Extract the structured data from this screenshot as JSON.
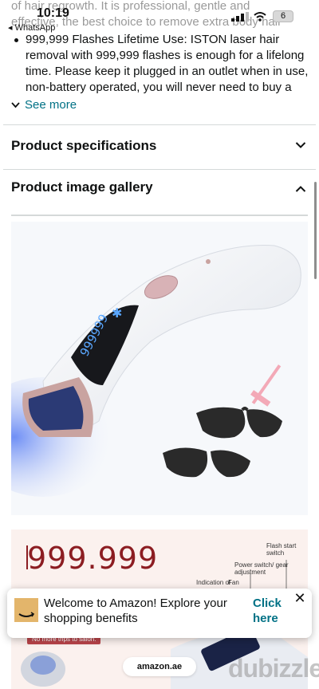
{
  "status_bar": {
    "time": "10:19",
    "back_app": "WhatsApp",
    "battery": "6"
  },
  "description": {
    "line1": "of hair regrowth. It is professional, gentle and",
    "line2": "effective, the best choice to remove extra body hair",
    "bullet": "999,999 Flashes Lifetime Use: ISTON laser hair removal with 999,999 flashes is enough for a lifelong time. Please keep it plugged in an outlet when in use, non-battery operated, you will never need to buy a",
    "see_more": "See more"
  },
  "sections": {
    "specifications": "Product specifications",
    "gallery": "Product image gallery"
  },
  "gallery": {
    "image1": {
      "device_screen": "999999"
    },
    "image2": {
      "big_number": "999.999",
      "callouts": [
        "Flash start switch",
        "Power switch/ gear adjustment",
        "Indication of",
        "Fan"
      ],
      "tag": "No more trips to salon."
    }
  },
  "banner": {
    "message": "Welcome to Amazon! Explore your shopping benefits",
    "link": "Click here",
    "close": "✕"
  },
  "url": "amazon.ae",
  "watermark": "dubizzle",
  "colors": {
    "link": "#007185",
    "accent": "#ff9900",
    "divider": "#d5d9d9"
  }
}
